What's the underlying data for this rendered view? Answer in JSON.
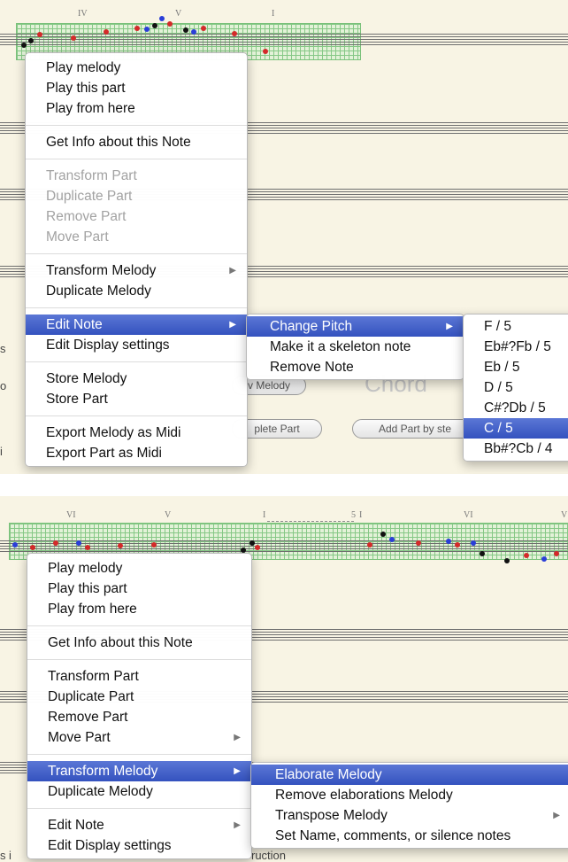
{
  "top_panel": {
    "roman_numerals": [
      "IV",
      "V",
      "I"
    ],
    "background_texts": {
      "s": "s",
      "o": "o",
      "i": "i",
      "melody_button": "v Melody",
      "chord_word": "Chord"
    },
    "buttons": [
      "plete Part",
      "Add Part by ste"
    ],
    "context_menu": {
      "groups": [
        [
          {
            "label": "Play melody"
          },
          {
            "label": "Play this part"
          },
          {
            "label": "Play from here"
          }
        ],
        [
          {
            "label": "Get Info about this Note"
          }
        ],
        [
          {
            "label": "Transform Part",
            "disabled": true
          },
          {
            "label": "Duplicate Part",
            "disabled": true
          },
          {
            "label": "Remove Part",
            "disabled": true
          },
          {
            "label": "Move Part",
            "disabled": true
          }
        ],
        [
          {
            "label": "Transform Melody",
            "submenu": true
          },
          {
            "label": "Duplicate Melody"
          }
        ],
        [
          {
            "label": "Edit Note",
            "submenu": true,
            "highlighted": true
          },
          {
            "label": "Edit Display settings"
          }
        ],
        [
          {
            "label": "Store Melody"
          },
          {
            "label": "Store Part"
          }
        ],
        [
          {
            "label": "Export Melody as Midi"
          },
          {
            "label": "Export Part as Midi"
          }
        ]
      ]
    },
    "edit_note_submenu": [
      {
        "label": "Change Pitch",
        "submenu": true,
        "highlighted": true
      },
      {
        "label": "Make it a skeleton note"
      },
      {
        "label": "Remove Note"
      }
    ],
    "pitch_submenu": [
      {
        "label": "F / 5"
      },
      {
        "label": "Eb#?Fb / 5"
      },
      {
        "label": "Eb / 5"
      },
      {
        "label": "D / 5"
      },
      {
        "label": "C#?Db / 5"
      },
      {
        "label": "C / 5",
        "highlighted": true
      },
      {
        "label": "Bb#?Cb / 4"
      }
    ]
  },
  "bottom_panel": {
    "roman_numerals": [
      "VI",
      "V",
      "I",
      "5",
      "I",
      "VI",
      "V"
    ],
    "background_texts": {
      "s": "s",
      "i": "i",
      "truction": "ruction"
    },
    "context_menu": {
      "groups": [
        [
          {
            "label": "Play melody"
          },
          {
            "label": "Play this part"
          },
          {
            "label": "Play from here"
          }
        ],
        [
          {
            "label": "Get Info about this Note"
          }
        ],
        [
          {
            "label": "Transform Part"
          },
          {
            "label": "Duplicate Part"
          },
          {
            "label": "Remove Part"
          },
          {
            "label": "Move Part",
            "submenu": true
          }
        ],
        [
          {
            "label": "Transform Melody",
            "submenu": true,
            "highlighted": true
          },
          {
            "label": "Duplicate Melody"
          }
        ],
        [
          {
            "label": "Edit Note",
            "submenu": true
          },
          {
            "label": "Edit Display settings"
          }
        ]
      ]
    },
    "transform_submenu": [
      {
        "label": "Elaborate Melody",
        "highlighted": true
      },
      {
        "label": "Remove elaborations Melody"
      },
      {
        "label": "Transpose Melody",
        "submenu": true
      },
      {
        "label": "Set Name, comments, or silence notes"
      }
    ]
  },
  "icons": {
    "submenu_arrow": "triangle-right-icon"
  },
  "colors": {
    "highlight": "#3f5cc8",
    "note_red": "#d42a2a",
    "note_blue": "#2a3ed8",
    "note_black": "#111111",
    "grid_green": "#7ac17a"
  }
}
